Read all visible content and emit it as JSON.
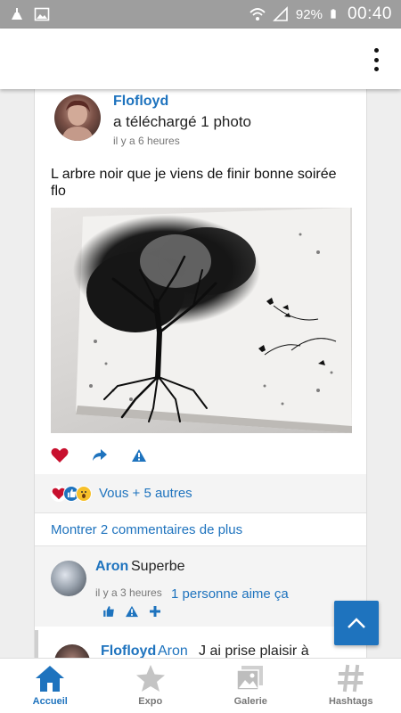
{
  "status_bar": {
    "battery": "92%",
    "time": "00:40"
  },
  "post": {
    "author": "Flofloyd",
    "action": "a téléchargé 1 photo",
    "time": "il y a 6 heures",
    "text": "L arbre noir que je viens de finir bonne soirée flo",
    "likes_text": "Vous + 5 autres",
    "more_comments": "Montrer 2 commentaires de plus"
  },
  "comment": {
    "author": "Aron",
    "text": "Superbe",
    "time": "il y a 3 heures",
    "likes": "1 personne aime ça"
  },
  "reply": {
    "author": "Flofloyd",
    "mention": "Aron",
    "text": "J ai prise plaisir à"
  },
  "bottom_nav": {
    "items": [
      {
        "label": "Accueil",
        "icon": "home-icon",
        "active": true
      },
      {
        "label": "Expo",
        "icon": "star-icon",
        "active": false
      },
      {
        "label": "Galerie",
        "icon": "gallery-icon",
        "active": false
      },
      {
        "label": "Hashtags",
        "icon": "hashtag-icon",
        "active": false
      }
    ]
  },
  "colors": {
    "accent": "#1e73be",
    "heart": "#c8102e",
    "status_bar": "#9e9e9e"
  }
}
